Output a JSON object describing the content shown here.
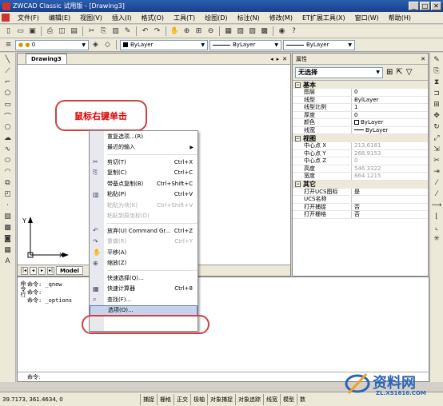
{
  "app": {
    "title": "ZWCAD Classic 试用版 - [Drawing3]"
  },
  "menu": [
    "文件(F)",
    "编辑(E)",
    "视图(V)",
    "插入(I)",
    "格式(O)",
    "工具(T)",
    "绘图(D)",
    "标注(N)",
    "修改(M)",
    "ET扩展工具(X)",
    "窗口(W)",
    "帮助(H)"
  ],
  "layer": {
    "current": "0",
    "color": "ByLayer",
    "linetype": "ByLayer",
    "lineweight": "ByLayer"
  },
  "drawing": {
    "tab": "Drawing3",
    "model_tab": "Model"
  },
  "callout": {
    "text": "鼠标右键单击"
  },
  "ucs": {
    "x_label": "X",
    "y_label": "Y"
  },
  "properties": {
    "title": "属性",
    "selection": "无选择",
    "sections": [
      {
        "name": "基本",
        "rows": [
          {
            "k": "图层",
            "v": "0"
          },
          {
            "k": "线型",
            "v": "BylLayer"
          },
          {
            "k": "线型比例",
            "v": "1"
          },
          {
            "k": "厚度",
            "v": "0"
          },
          {
            "k": "颜色",
            "v": "ByLayer"
          },
          {
            "k": "线宽",
            "v": "ByLayer"
          }
        ]
      },
      {
        "name": "视图",
        "rows": [
          {
            "k": "中心点 X",
            "v": "213.6181",
            "grey": true
          },
          {
            "k": "中心点 Y",
            "v": "268.9153",
            "grey": true
          },
          {
            "k": "中心点 Z",
            "v": "0",
            "grey": true
          },
          {
            "k": "高度",
            "v": "546.3322",
            "grey": true
          },
          {
            "k": "宽度",
            "v": "864.1215",
            "grey": true
          }
        ]
      },
      {
        "name": "其它",
        "rows": [
          {
            "k": "打开UCS图标",
            "v": "是"
          },
          {
            "k": "UCS名称",
            "v": ""
          },
          {
            "k": "打开捕捉",
            "v": "否"
          },
          {
            "k": "打开栅格",
            "v": "否"
          }
        ]
      }
    ]
  },
  "context_menu": [
    {
      "label": "重复选项...(R)",
      "shortcut": "",
      "icon": "",
      "disabled": false
    },
    {
      "label": "最近的输入",
      "shortcut": "",
      "icon": "",
      "disabled": false,
      "submenu": true
    },
    {
      "sep": true
    },
    {
      "label": "剪切(T)",
      "shortcut": "Ctrl+X",
      "icon": "scissors-icon",
      "disabled": false
    },
    {
      "label": "复制(C)",
      "shortcut": "Ctrl+C",
      "icon": "copy-icon",
      "disabled": false
    },
    {
      "label": "带基点复制(B)",
      "shortcut": "Ctrl+Shift+C",
      "icon": "",
      "disabled": false
    },
    {
      "label": "粘贴(P)",
      "shortcut": "Ctrl+V",
      "icon": "paste-icon",
      "disabled": false
    },
    {
      "label": "粘贴为块(K)",
      "shortcut": "Ctrl+Shift+V",
      "icon": "",
      "disabled": true
    },
    {
      "label": "粘贴到原坐标(D)",
      "shortcut": "",
      "icon": "",
      "disabled": true
    },
    {
      "sep": true
    },
    {
      "label": "放弃(U) Command Gr...",
      "shortcut": "Ctrl+Z",
      "icon": "undo-icon",
      "disabled": false
    },
    {
      "label": "重做(R)",
      "shortcut": "Ctrl+Y",
      "icon": "redo-icon",
      "disabled": true
    },
    {
      "label": "平移(A)",
      "shortcut": "",
      "icon": "pan-icon",
      "disabled": false
    },
    {
      "label": "缩放(Z)",
      "shortcut": "",
      "icon": "zoom-icon",
      "disabled": false
    },
    {
      "sep": true
    },
    {
      "label": "快速选择(Q)...",
      "shortcut": "",
      "icon": "",
      "disabled": false
    },
    {
      "label": "快速计算器",
      "shortcut": "Ctrl+8",
      "icon": "calculator-icon",
      "disabled": false
    },
    {
      "label": "查找(F)...",
      "shortcut": "",
      "icon": "find-icon",
      "disabled": false
    },
    {
      "label": "选项(O)...",
      "shortcut": "",
      "icon": "",
      "disabled": false,
      "highlight": true
    }
  ],
  "command": {
    "side_label": "命令行",
    "lines": [
      "命令: _qnew",
      "命令:",
      "命令: _options"
    ],
    "prompt": "命令:"
  },
  "status": {
    "coords": "39.7173, 361.4634, 0",
    "buttons": [
      "捕捉",
      "栅格",
      "正交",
      "极轴",
      "对象捕捉",
      "对象追踪",
      "线宽",
      "模型",
      "数"
    ]
  },
  "watermark": {
    "text": "资料网",
    "url": "ZL.XS1616.COM"
  }
}
